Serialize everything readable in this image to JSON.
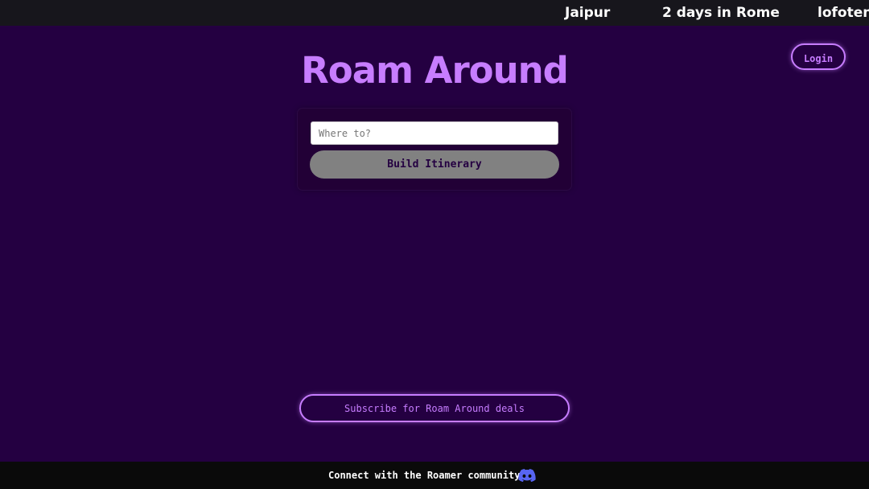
{
  "ticker": {
    "items": [
      "Jaipur",
      "2 days in Rome",
      "lofoten"
    ]
  },
  "header": {
    "login_label": "Login"
  },
  "main": {
    "title": "Roam Around",
    "destination_placeholder": "Where to?",
    "build_label": "Build Itinerary",
    "subscribe_label": "Subscribe for Roam Around deals"
  },
  "footer": {
    "community_text": "Connect with the Roamer community",
    "community_icon": "discord-icon"
  },
  "colors": {
    "background": "#240041",
    "accent": "#c77dff",
    "ticker_bg": "#17161c",
    "footer_bg": "#0a0a0a",
    "build_button_bg": "#818181",
    "discord": "#5865f2"
  }
}
